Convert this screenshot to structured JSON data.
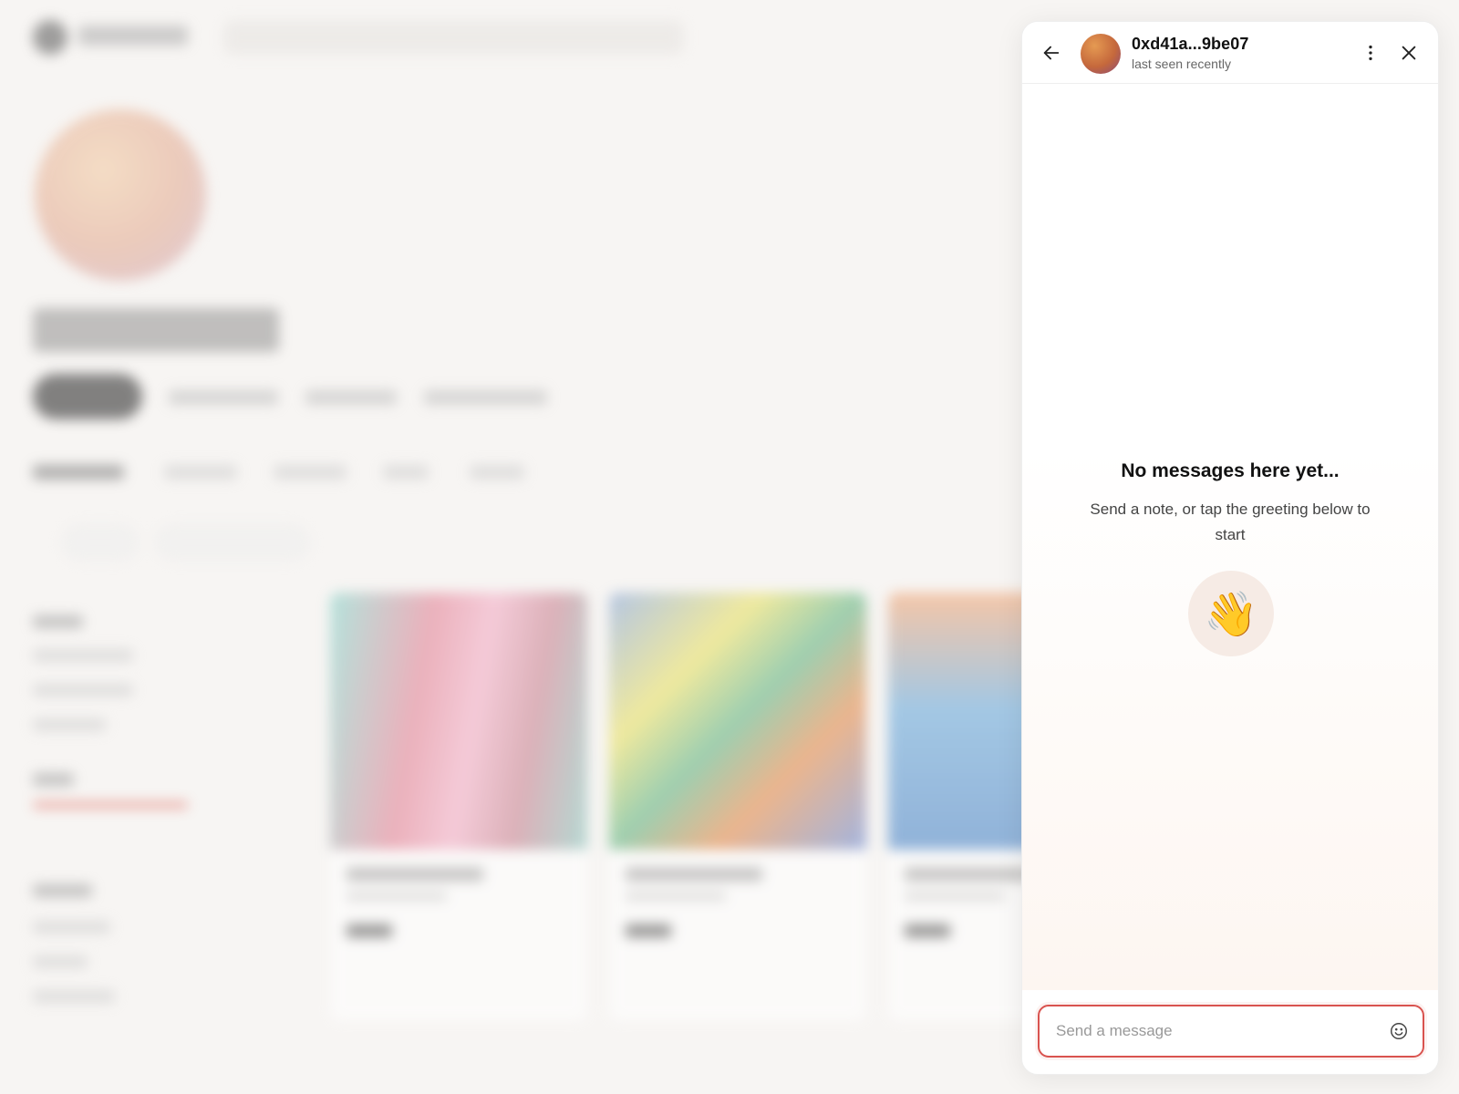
{
  "chat": {
    "contact_name": "0xd41a...9be07",
    "contact_status": "last seen recently",
    "empty_title": "No messages here yet...",
    "empty_subtitle": "Send a note, or tap the greeting below to start",
    "greeting_emoji": "👋",
    "input_placeholder": "Send a message",
    "icons": {
      "back": "arrow-left-icon",
      "more": "more-vertical-icon",
      "close": "close-icon",
      "emoji": "smiley-icon"
    },
    "accent_color": "#d9534f"
  }
}
